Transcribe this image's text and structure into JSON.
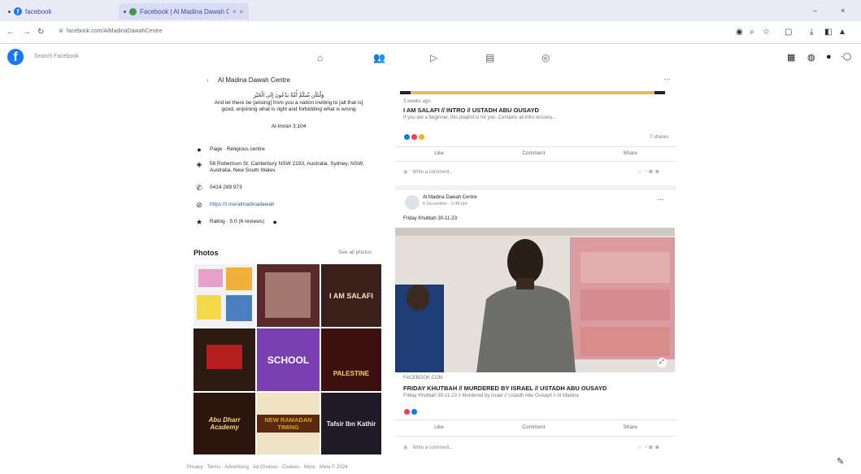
{
  "browser": {
    "tabs": [
      {
        "label": "facebook",
        "active": false
      },
      {
        "label": "Facebook | Al Madina Dawah Centre",
        "active": true
      }
    ],
    "new_tab": "+",
    "url": "facebook.com/AlMadinaDawahCentre",
    "controls": {
      "minimize": "–",
      "close": "×"
    }
  },
  "fbnav": {
    "search_placeholder": "Search Facebook",
    "logo": "f"
  },
  "intro": {
    "page_name": "Al Madina Dawah Centre",
    "arabic": "وَلْتَكُن مِّنكُمْ أُمَّةٌ يَدْعُونَ إِلَى الْخَيْرِ",
    "line1": "And let there be [arising] from you a nation inviting to [all that is]",
    "line2": "good, enjoining what is right and forbidding what is wrong",
    "ref": "Al-Imran 3:104",
    "page_type": "Page · Religious centre",
    "address": "56 Robertson St, Canterbury NSW 2193, Australia, Sydney, NSW, Australia, New South Wales",
    "phone": "0414 289 973",
    "website": "https://t.me/almadinadawah",
    "rating": "Rating · 5.0 (6 reviews)"
  },
  "photos": {
    "title": "Photos",
    "see_all": "See all photos",
    "tiles": [
      {
        "text": "",
        "bg": "#4a7fbf"
      },
      {
        "text": "",
        "bg": "#5a2a2a"
      },
      {
        "text": "I AM SALAFI",
        "bg": "#3b1f1a"
      },
      {
        "text": "",
        "bg": "#2a1a12"
      },
      {
        "text": "SCHOOL",
        "bg": "#7a3fb0"
      },
      {
        "text": "PALESTINE",
        "bg": "#3a1010"
      },
      {
        "text": "Abu Dharr Academy",
        "bg": "#2b160e"
      },
      {
        "text": "NEW RAMADAN TIMING",
        "bg": "#efe3c4"
      },
      {
        "text": "Tafsir Ibn Kathir",
        "bg": "#1f1a26"
      }
    ]
  },
  "footer": "Privacy · Terms · Advertising · Ad Choices · Cookies · More · Meta © 2024",
  "feed": {
    "post1": {
      "meta": "3 weeks ago",
      "title": "I AM SALAFI // INTRO // USTADH ABU OUSAYD",
      "sub": "If you are a beginner, this playlist is for you. Contains all intro lessons...",
      "count": "7 shares",
      "like": "Like",
      "comment": "Comment",
      "share": "Share",
      "write": "Write a comment..."
    },
    "post2": {
      "page": "Al Madina Dawah Centre",
      "time": "6 December · 2:48 pm",
      "text": "Friday Khutbah 30-11-23",
      "meta": "FACEBOOK.COM",
      "title": "FRIDAY KHUTBAH // MURDERED BY ISRAEL // USTADH ABU OUSAYD",
      "sub": "Friday Khutbah 30-11-23 // Murdered by Israel // Ustadh Abu Ousayd // Al Madina",
      "like": "Like",
      "comment": "Comment",
      "share": "Share",
      "write": "Write a comment..."
    }
  },
  "colors": {
    "brand": "#1877f2",
    "gold": "#e8b860"
  }
}
